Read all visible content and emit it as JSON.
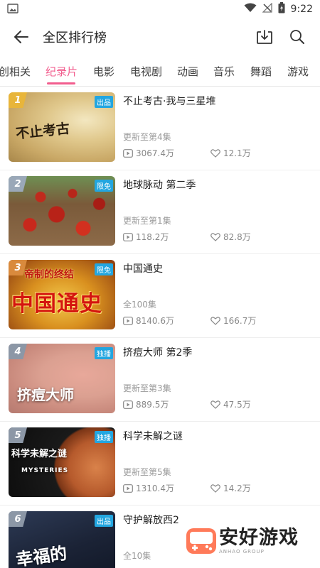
{
  "status_bar": {
    "time": "9:22",
    "icons": [
      "image-icon",
      "wifi-icon",
      "no-signal-icon",
      "battery-charging-icon"
    ]
  },
  "header": {
    "title": "全区排行榜",
    "back_icon": "back-arrow-icon",
    "download_icon": "download-icon",
    "search_icon": "search-icon"
  },
  "tabs": [
    {
      "label": "创相关",
      "active": false
    },
    {
      "label": "纪录片",
      "active": true
    },
    {
      "label": "电影",
      "active": false
    },
    {
      "label": "电视剧",
      "active": false
    },
    {
      "label": "动画",
      "active": false
    },
    {
      "label": "音乐",
      "active": false
    },
    {
      "label": "舞蹈",
      "active": false
    },
    {
      "label": "游戏",
      "active": false
    }
  ],
  "accent_color": "#f25d8e",
  "items": [
    {
      "rank": "1",
      "badge": "出品",
      "title": "不止考古·我与三星堆",
      "subtitle": "更新至第4集",
      "plays": "3067.4万",
      "likes": "12.1万",
      "thumb_text": "不止考古",
      "thumb_caption": ""
    },
    {
      "rank": "2",
      "badge": "限免",
      "title": "地球脉动 第二季",
      "subtitle": "更新至第1集",
      "plays": "118.2万",
      "likes": "82.8万",
      "thumb_text": "",
      "thumb_caption": ""
    },
    {
      "rank": "3",
      "badge": "限免",
      "title": "中国通史",
      "subtitle": "全100集",
      "plays": "8140.6万",
      "likes": "166.7万",
      "thumb_text": "中国通史",
      "thumb_caption": "帝制的终结"
    },
    {
      "rank": "4",
      "badge": "独播",
      "title": "挤痘大师 第2季",
      "subtitle": "更新至第3集",
      "plays": "889.5万",
      "likes": "47.5万",
      "thumb_text": "挤痘大师",
      "thumb_caption": ""
    },
    {
      "rank": "5",
      "badge": "独播",
      "title": "科学未解之谜",
      "subtitle": "更新至第5集",
      "plays": "1310.4万",
      "likes": "14.2万",
      "thumb_text": "科学未解之谜",
      "thumb_caption": "MYSTERIES"
    },
    {
      "rank": "6",
      "badge": "出品",
      "title": "守护解放西2",
      "subtitle": "全10集",
      "plays": "",
      "likes": "",
      "thumb_text": "幸福的",
      "thumb_caption": ""
    }
  ],
  "watermark": {
    "main": "安好游戏",
    "small": "ANHAO GROUP"
  }
}
